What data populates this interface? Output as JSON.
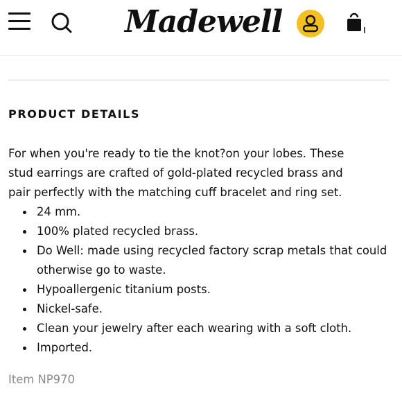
{
  "header": {
    "menu_icon": "hamburger-menu-icon",
    "search_icon": "search-icon",
    "logo_text": "Madewell",
    "account_icon": "user-icon",
    "account_color": "#f5bf1e",
    "bag_icon": "shopping-bag-icon"
  },
  "product_details": {
    "title": "PRODUCT DETAILS",
    "description_lines": [
      "For when you're ready to tie the knot?on your lobes. These",
      "stud earrings are crafted of gold-plated recycled brass and",
      "pair perfectly with the matching cuff bracelet and ring set."
    ],
    "bullets": [
      "24 mm.",
      "100% plated recycled brass.",
      "Do Well: made using recycled factory scrap metals that could otherwise go to waste.",
      "Hypoallergenic titanium posts.",
      "Nickel-safe.",
      "Clean your jewelry after each wearing with a soft cloth.",
      "Imported."
    ],
    "item_number": "Item NP970"
  }
}
